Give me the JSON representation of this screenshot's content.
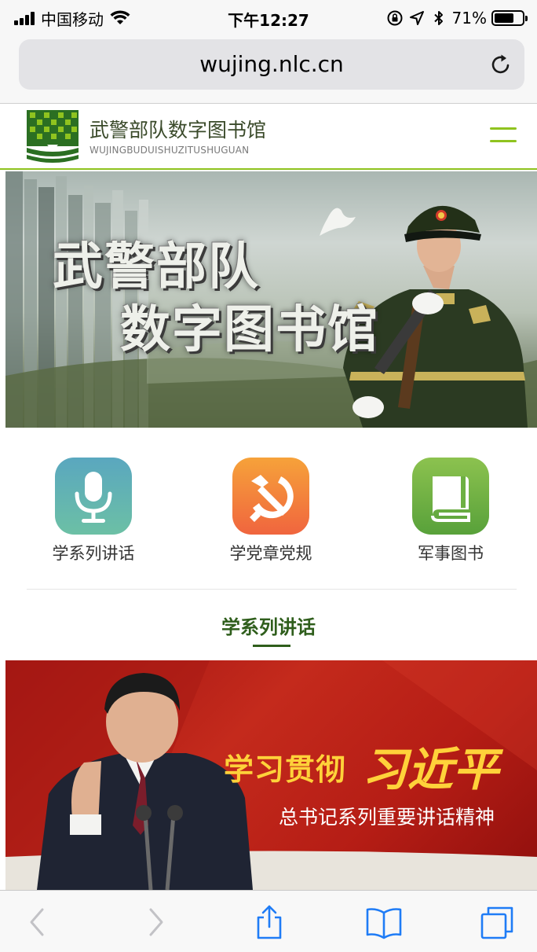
{
  "status_bar": {
    "carrier": "中国移动",
    "time": "下午12:27",
    "battery_percent": "71%",
    "battery_level": 0.71
  },
  "browser": {
    "url": "wujing.nlc.cn"
  },
  "site": {
    "title": "武警部队数字图书馆",
    "subtitle": "WUJINGBUDUISHUZITUSHUGUAN",
    "accent_color": "#8fc31f"
  },
  "hero": {
    "line1": "武警部队",
    "line2": "数字图书馆"
  },
  "quick_nav": [
    {
      "label": "学系列讲话",
      "icon": "microphone-icon",
      "color": "#5aa7bf"
    },
    {
      "label": "学党章党规",
      "icon": "hammer-sickle-icon",
      "color": "#f0653e"
    },
    {
      "label": "军事图书",
      "icon": "book-icon",
      "color": "#58a13a"
    }
  ],
  "section": {
    "title": "学系列讲话"
  },
  "feature_banner": {
    "line1": "学习贯彻",
    "name": "习近平",
    "line2": "总书记系列重要讲话精神"
  },
  "toolbar": {
    "icons": [
      "back-icon",
      "forward-icon",
      "share-icon",
      "bookmarks-icon",
      "tabs-icon"
    ]
  }
}
